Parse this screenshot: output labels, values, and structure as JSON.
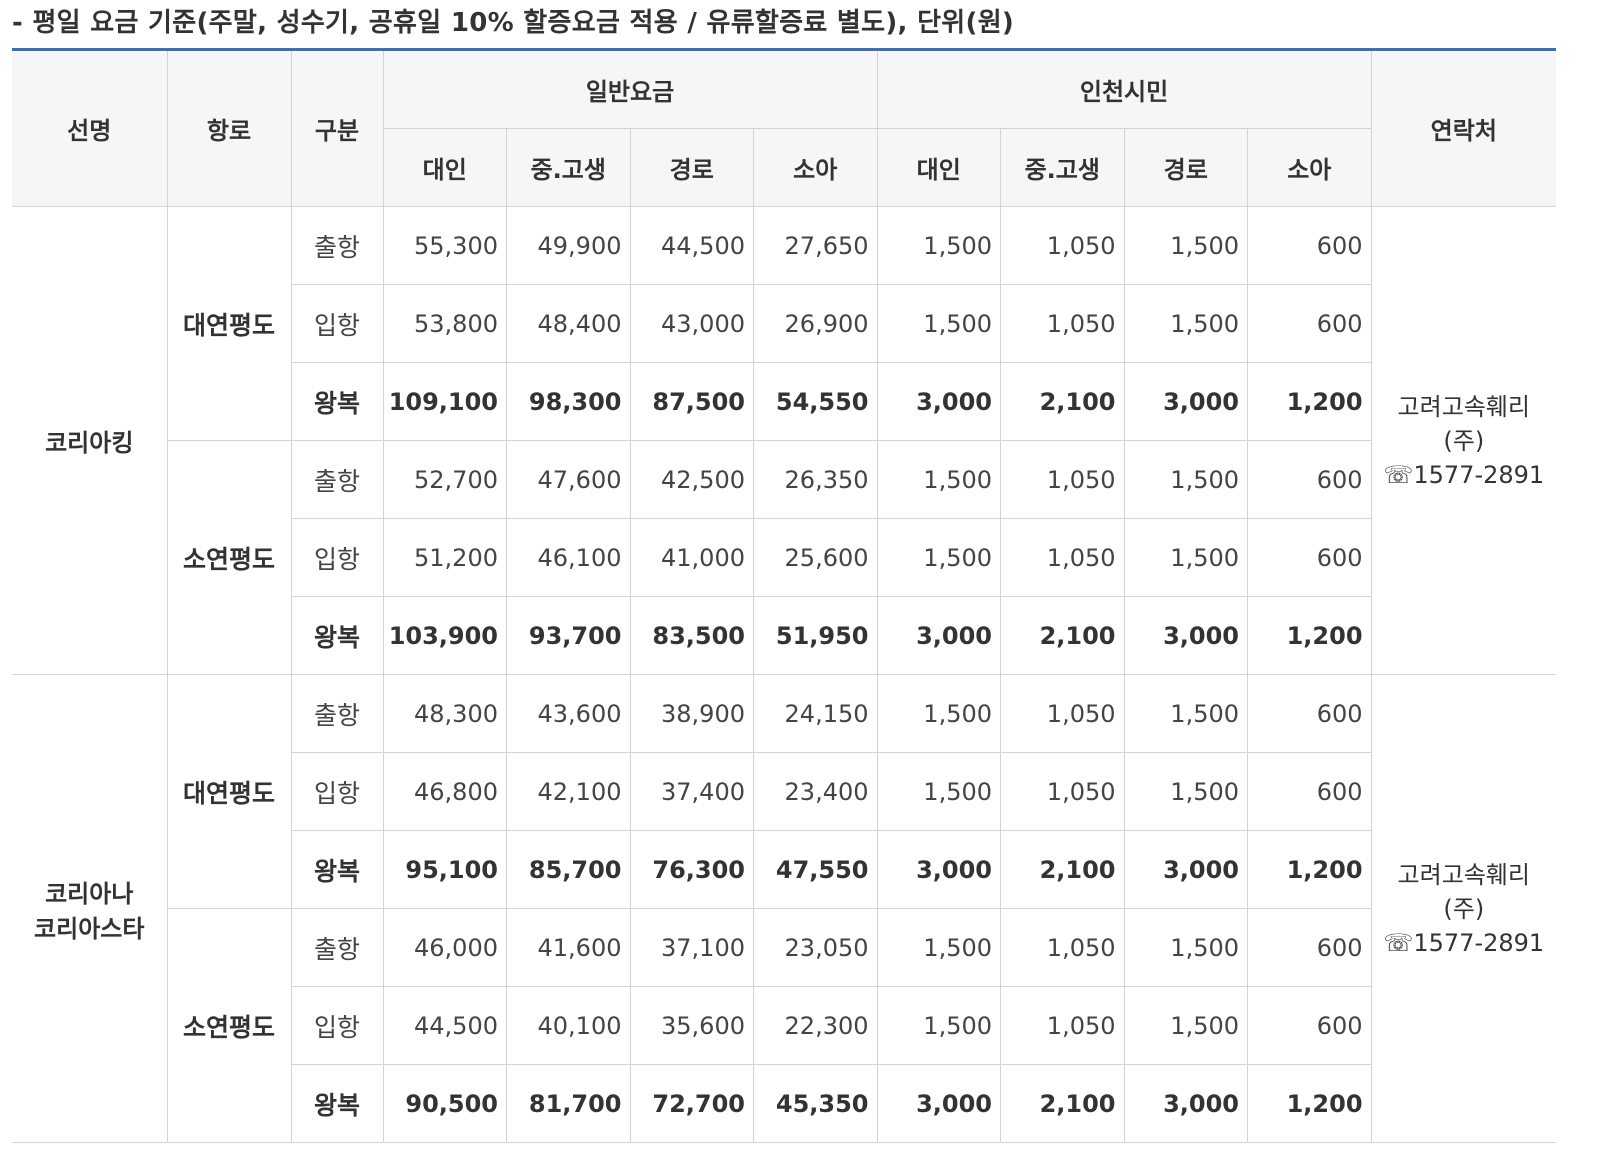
{
  "title": "- 평일 요금 기준(주말, 성수기, 공휴일 10% 할증요금 적용 / 유류할증료 별도), 단위(원)",
  "header": {
    "ship": "선명",
    "route": "항로",
    "type": "구분",
    "general": "일반요금",
    "citizen": "인천시민",
    "contact": "연락처",
    "sub": [
      "대인",
      "중.고생",
      "경로",
      "소아",
      "대인",
      "중.고생",
      "경로",
      "소아"
    ]
  },
  "groups": [
    {
      "ship": "코리아킹",
      "contact": {
        "company": "고려고속훼리",
        "suffix": "(주)",
        "phone": "☏1577-2891"
      },
      "routes": [
        {
          "name": "대연평도",
          "rows": [
            {
              "type": "출항",
              "values": [
                "55,300",
                "49,900",
                "44,500",
                "27,650",
                "1,500",
                "1,050",
                "1,500",
                "600"
              ]
            },
            {
              "type": "입항",
              "values": [
                "53,800",
                "48,400",
                "43,000",
                "26,900",
                "1,500",
                "1,050",
                "1,500",
                "600"
              ]
            },
            {
              "type": "왕복",
              "values": [
                "109,100",
                "98,300",
                "87,500",
                "54,550",
                "3,000",
                "2,100",
                "3,000",
                "1,200"
              ]
            }
          ]
        },
        {
          "name": "소연평도",
          "rows": [
            {
              "type": "출항",
              "values": [
                "52,700",
                "47,600",
                "42,500",
                "26,350",
                "1,500",
                "1,050",
                "1,500",
                "600"
              ]
            },
            {
              "type": "입항",
              "values": [
                "51,200",
                "46,100",
                "41,000",
                "25,600",
                "1,500",
                "1,050",
                "1,500",
                "600"
              ]
            },
            {
              "type": "왕복",
              "values": [
                "103,900",
                "93,700",
                "83,500",
                "51,950",
                "3,000",
                "2,100",
                "3,000",
                "1,200"
              ]
            }
          ]
        }
      ]
    },
    {
      "ship": "코리아나\n코리아스타",
      "ship_lines": [
        "코리아나",
        "코리아스타"
      ],
      "contact": {
        "company": "고려고속훼리",
        "suffix": "(주)",
        "phone": "☏1577-2891"
      },
      "routes": [
        {
          "name": "대연평도",
          "rows": [
            {
              "type": "출항",
              "values": [
                "48,300",
                "43,600",
                "38,900",
                "24,150",
                "1,500",
                "1,050",
                "1,500",
                "600"
              ]
            },
            {
              "type": "입항",
              "values": [
                "46,800",
                "42,100",
                "37,400",
                "23,400",
                "1,500",
                "1,050",
                "1,500",
                "600"
              ]
            },
            {
              "type": "왕복",
              "values": [
                "95,100",
                "85,700",
                "76,300",
                "47,550",
                "3,000",
                "2,100",
                "3,000",
                "1,200"
              ]
            }
          ]
        },
        {
          "name": "소연평도",
          "rows": [
            {
              "type": "출항",
              "values": [
                "46,000",
                "41,600",
                "37,100",
                "23,050",
                "1,500",
                "1,050",
                "1,500",
                "600"
              ]
            },
            {
              "type": "입항",
              "values": [
                "44,500",
                "40,100",
                "35,600",
                "22,300",
                "1,500",
                "1,050",
                "1,500",
                "600"
              ]
            },
            {
              "type": "왕복",
              "values": [
                "90,500",
                "81,700",
                "72,700",
                "45,350",
                "3,000",
                "2,100",
                "3,000",
                "1,200"
              ]
            }
          ]
        }
      ]
    }
  ],
  "colors": {
    "accent_border": "#3b6fbd",
    "header_bg": "#f6f6f6",
    "grid": "#cfd3da"
  }
}
